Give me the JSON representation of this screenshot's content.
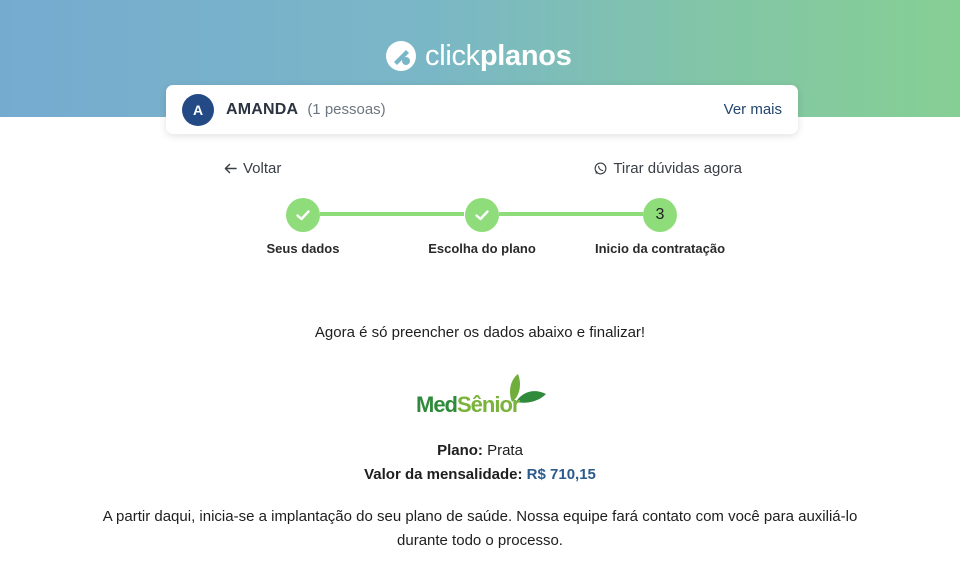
{
  "brand": {
    "logo_light": "click",
    "logo_bold": "planos"
  },
  "user": {
    "initial": "A",
    "name": "AMANDA",
    "count": "(1 pessoas)",
    "more": "Ver mais"
  },
  "nav": {
    "back": "Voltar",
    "help": "Tirar dúvidas agora"
  },
  "steps": [
    {
      "label": "Seus dados",
      "state": "done"
    },
    {
      "label": "Escolha do plano",
      "state": "done"
    },
    {
      "label": "Inicio da contratação",
      "state": "current",
      "number": "3"
    }
  ],
  "intro": "Agora é só preencher os dados abaixo e finalizar!",
  "operator": {
    "name_part1": "Med",
    "name_part2": "Sênior"
  },
  "plan": {
    "plan_label": "Plano:",
    "plan_value": "Prata",
    "price_label": "Valor da mensalidade:",
    "price_value": "R$ 710,15"
  },
  "disclaimer": "A partir daqui, inicia-se a implantação do seu plano de saúde. Nossa equipe fará contato com você para auxiliá-lo durante todo o processo.",
  "colors": {
    "step_active": "#8fdc7a",
    "avatar": "#244a86",
    "price": "#2b5a8c"
  }
}
